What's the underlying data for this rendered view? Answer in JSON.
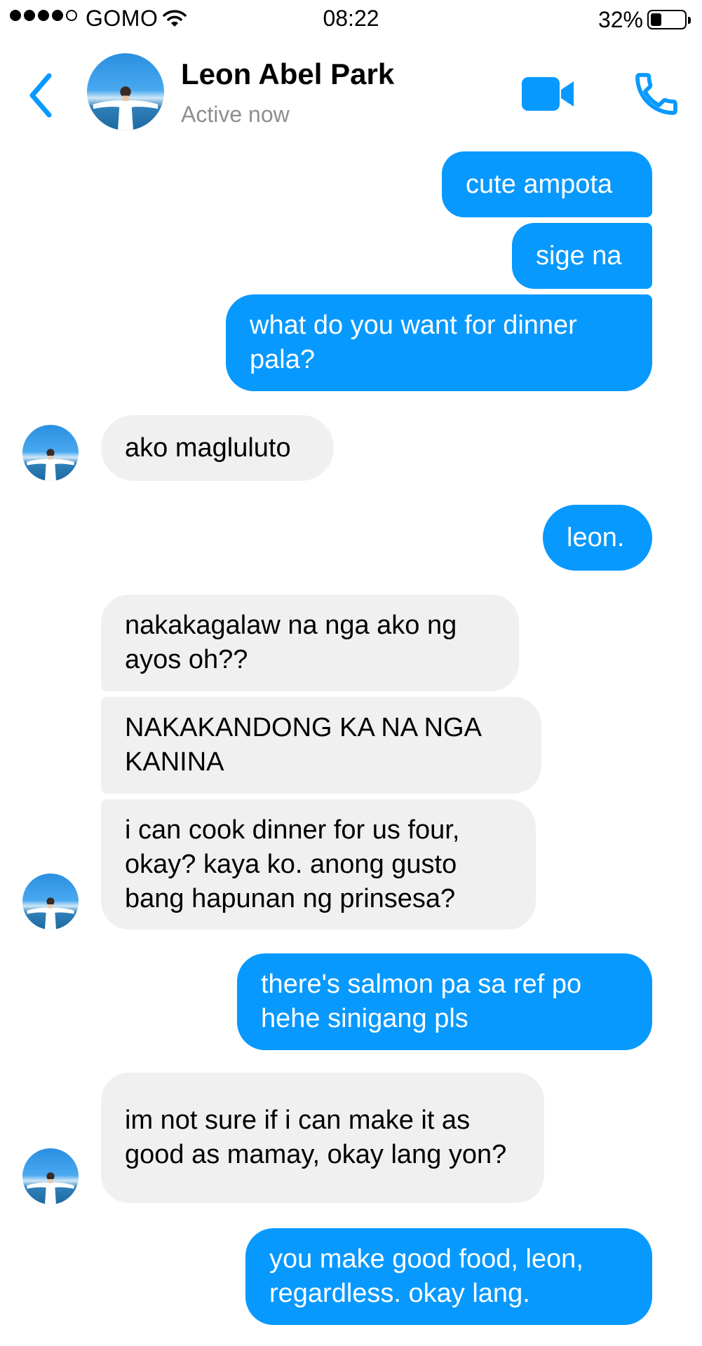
{
  "status_bar": {
    "carrier": "GOMO",
    "time": "08:22",
    "battery_percent": "32%",
    "battery_level": 0.32,
    "signal_bars": 4,
    "signal_max": 5
  },
  "header": {
    "contact_name": "Leon Abel Park",
    "presence": "Active now",
    "icons": [
      "chevron-left-icon",
      "video-camera-icon",
      "phone-icon"
    ],
    "accent_color": "#0899ff"
  },
  "messages": [
    {
      "sender": "me",
      "text": "cute ampota"
    },
    {
      "sender": "me",
      "text": "sige na"
    },
    {
      "sender": "me",
      "text": "what do you want for dinner pala?"
    },
    {
      "sender": "contact",
      "text": "ako magluluto"
    },
    {
      "sender": "me",
      "text": "leon."
    },
    {
      "sender": "contact",
      "text": "nakakagalaw na nga ako ng ayos oh??"
    },
    {
      "sender": "contact",
      "text": "NAKAKANDONG KA NA NGA KANINA"
    },
    {
      "sender": "contact",
      "text": "i can cook dinner for us four, okay? kaya ko. anong gusto bang hapunan ng prinsesa?"
    },
    {
      "sender": "me",
      "text": "there's salmon pa sa ref po hehe sinigang pls"
    },
    {
      "sender": "contact",
      "text": "im not sure if i can make it as good as mamay, okay lang yon?"
    },
    {
      "sender": "me",
      "text": "you make good food, leon, regardless. okay lang."
    }
  ],
  "colors": {
    "outgoing_bubble": "#0899ff",
    "incoming_bubble": "#f0f0f0",
    "secondary_text": "#8e8e93"
  }
}
